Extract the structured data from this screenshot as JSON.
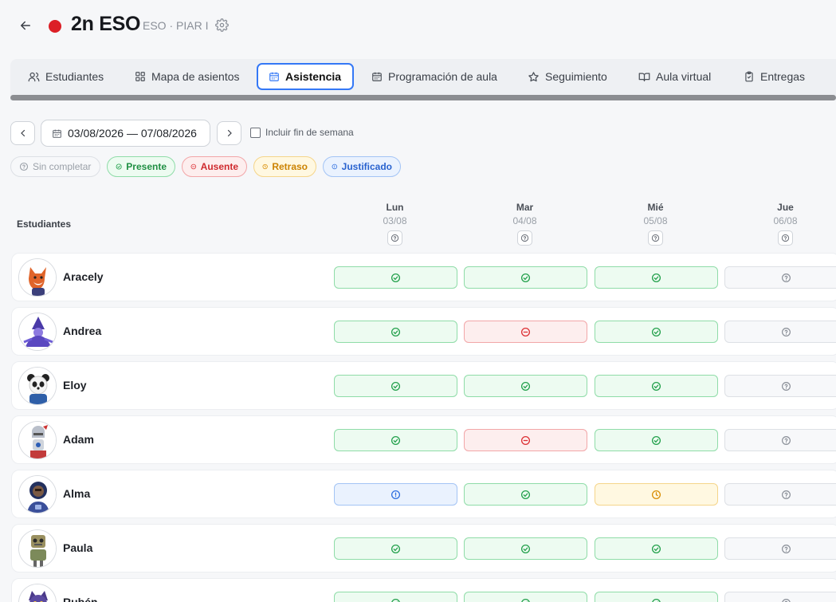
{
  "header": {
    "title": "2n ESO",
    "subtitle": "ESO · PIAR I",
    "color": "#dc1f26"
  },
  "tabs": [
    {
      "label": "Estudiantes",
      "icon": "users-icon"
    },
    {
      "label": "Mapa de asientos",
      "icon": "grid-icon"
    },
    {
      "label": "Asistencia",
      "icon": "calendar-icon",
      "active": true
    },
    {
      "label": "Programación de aula",
      "icon": "calendar-icon"
    },
    {
      "label": "Seguimiento",
      "icon": "star-icon"
    },
    {
      "label": "Aula virtual",
      "icon": "book-icon"
    },
    {
      "label": "Entregas",
      "icon": "clipboard-icon"
    }
  ],
  "controls": {
    "date_range": "03/08/2026 — 07/08/2026",
    "weekend_label": "Incluir fin de semana",
    "weekend_checked": false
  },
  "legend": {
    "none": "Sin completar",
    "present": "Presente",
    "absent": "Ausente",
    "late": "Retraso",
    "justified": "Justificado"
  },
  "table": {
    "students_header": "Estudiantes",
    "days": [
      {
        "name": "Lun",
        "date": "03/08"
      },
      {
        "name": "Mar",
        "date": "04/08"
      },
      {
        "name": "Mié",
        "date": "05/08"
      },
      {
        "name": "Jue",
        "date": "06/08"
      }
    ],
    "students": [
      {
        "name": "Aracely",
        "avatar": "fox-avatar",
        "status": [
          "present",
          "present",
          "present",
          "none"
        ]
      },
      {
        "name": "Andrea",
        "avatar": "wizard-avatar",
        "status": [
          "present",
          "absent",
          "present",
          "none"
        ]
      },
      {
        "name": "Eloy",
        "avatar": "panda-avatar",
        "status": [
          "present",
          "present",
          "present",
          "none"
        ]
      },
      {
        "name": "Adam",
        "avatar": "knight-avatar",
        "status": [
          "present",
          "absent",
          "present",
          "none"
        ]
      },
      {
        "name": "Alma",
        "avatar": "astronaut-avatar",
        "status": [
          "justified",
          "present",
          "late",
          "none"
        ]
      },
      {
        "name": "Paula",
        "avatar": "robot-avatar",
        "status": [
          "present",
          "present",
          "present",
          "none"
        ]
      },
      {
        "name": "Rubén",
        "avatar": "cat-avatar",
        "status": [
          "present",
          "present",
          "present",
          "none"
        ]
      }
    ]
  },
  "status_colors": {
    "present": "#22a04b",
    "absent": "#dc2f33",
    "late": "#d98e05",
    "justified": "#2f6fe0",
    "none": "#8a8f98"
  }
}
